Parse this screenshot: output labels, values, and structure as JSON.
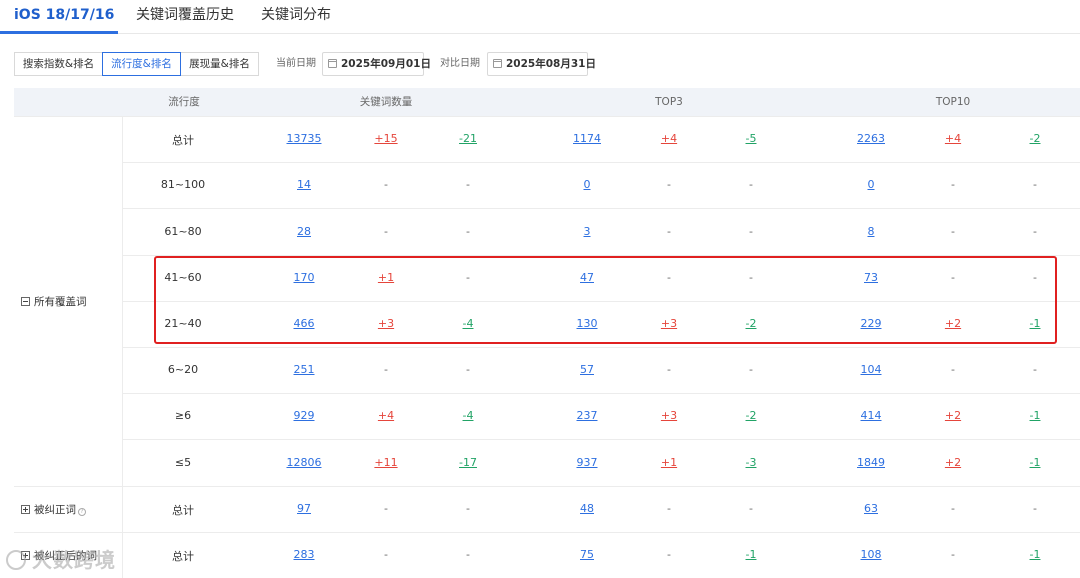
{
  "tabs": [
    "iOS 18/17/16",
    "关键词覆盖历史",
    "关键词分布"
  ],
  "toolbar": {
    "segments": [
      "搜索指数&排名",
      "流行度&排名",
      "展现量&排名"
    ],
    "active_segment": "流行度&排名",
    "current_date_label": "当前日期",
    "current_date": "2025年09月01日",
    "compare_date_label": "对比日期",
    "compare_date": "2025年08月31日"
  },
  "table": {
    "headers": [
      "流行度",
      "关键词数量",
      "TOP3",
      "TOP10"
    ],
    "groups": [
      {
        "label": "所有覆盖词",
        "expanded": true,
        "rows": [
          {
            "label": "总计",
            "kw": "13735",
            "kw_up": "+15",
            "kw_down": "-21",
            "t3": "1174",
            "t3_up": "+4",
            "t3_down": "-5",
            "t10": "2263",
            "t10_up": "+4",
            "t10_down": "-2"
          },
          {
            "label": "81~100",
            "kw": "14",
            "kw_up": "-",
            "kw_down": "-",
            "t3": "0",
            "t3_up": "-",
            "t3_down": "-",
            "t10": "0",
            "t10_up": "-",
            "t10_down": "-"
          },
          {
            "label": "61~80",
            "kw": "28",
            "kw_up": "-",
            "kw_down": "-",
            "t3": "3",
            "t3_up": "-",
            "t3_down": "-",
            "t10": "8",
            "t10_up": "-",
            "t10_down": "-"
          },
          {
            "label": "41~60",
            "kw": "170",
            "kw_up": "+1",
            "kw_down": "-",
            "t3": "47",
            "t3_up": "-",
            "t3_down": "-",
            "t10": "73",
            "t10_up": "-",
            "t10_down": "-"
          },
          {
            "label": "21~40",
            "kw": "466",
            "kw_up": "+3",
            "kw_down": "-4",
            "t3": "130",
            "t3_up": "+3",
            "t3_down": "-2",
            "t10": "229",
            "t10_up": "+2",
            "t10_down": "-1"
          },
          {
            "label": "6~20",
            "kw": "251",
            "kw_up": "-",
            "kw_down": "-",
            "t3": "57",
            "t3_up": "-",
            "t3_down": "-",
            "t10": "104",
            "t10_up": "-",
            "t10_down": "-"
          },
          {
            "label": "≥6",
            "kw": "929",
            "kw_up": "+4",
            "kw_down": "-4",
            "t3": "237",
            "t3_up": "+3",
            "t3_down": "-2",
            "t10": "414",
            "t10_up": "+2",
            "t10_down": "-1"
          },
          {
            "label": "≤5",
            "kw": "12806",
            "kw_up": "+11",
            "kw_down": "-17",
            "t3": "937",
            "t3_up": "+1",
            "t3_down": "-3",
            "t10": "1849",
            "t10_up": "+2",
            "t10_down": "-1"
          }
        ]
      },
      {
        "label": "被纠正词",
        "expanded": false,
        "rows": [
          {
            "label": "总计",
            "kw": "97",
            "kw_up": "-",
            "kw_down": "-",
            "t3": "48",
            "t3_up": "-",
            "t3_down": "-",
            "t10": "63",
            "t10_up": "-",
            "t10_down": "-"
          }
        ]
      },
      {
        "label": "被纠正后的词",
        "expanded": false,
        "rows": [
          {
            "label": "总计",
            "kw": "283",
            "kw_up": "-",
            "kw_down": "-",
            "t3": "75",
            "t3_up": "-",
            "t3_down": "-1",
            "t10": "108",
            "t10_up": "-",
            "t10_down": "-1"
          }
        ]
      }
    ]
  },
  "watermark": "大数跨境",
  "colors": {
    "accent": "#2d6fe0",
    "up": "#e5453b",
    "down": "#21a366",
    "highlight": "#e02020"
  }
}
